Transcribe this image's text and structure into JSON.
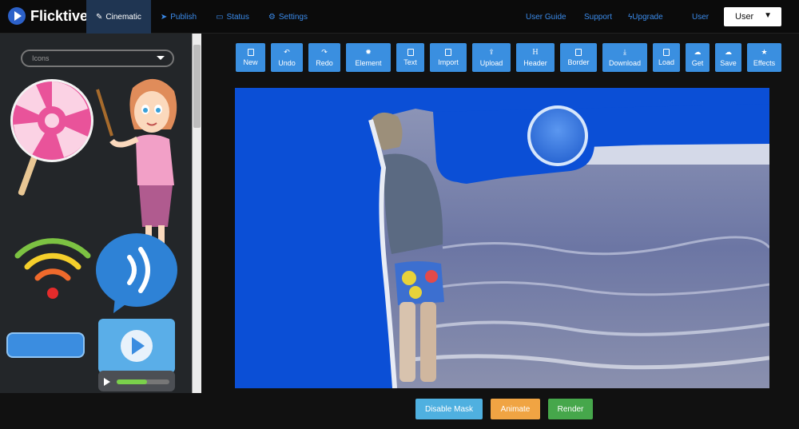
{
  "app": {
    "name": "Flicktive"
  },
  "nav": [
    {
      "label": "Cinematic",
      "icon": "pencil-icon",
      "active": true
    },
    {
      "label": "Publish",
      "icon": "paper-plane-icon",
      "active": false
    },
    {
      "label": "Status",
      "icon": "monitor-icon",
      "active": false
    },
    {
      "label": "Settings",
      "icon": "gear-icon",
      "active": false
    }
  ],
  "right_nav": {
    "user_guide": "User Guide",
    "support": "Support",
    "upgrade": "Upgrade",
    "user": "User"
  },
  "user_select": {
    "value": "User"
  },
  "sidebar": {
    "category": "Icons"
  },
  "toolbar": {
    "new": "New",
    "undo": "Undo",
    "redo": "Redo",
    "element": "Element",
    "text": "Text",
    "import": "Import",
    "upload": "Upload",
    "header": "Header",
    "border": "Border",
    "download": "Download",
    "load": "Load",
    "get": "Get",
    "save": "Save",
    "effects": "Effects"
  },
  "bottom": {
    "disable_mask": "Disable Mask",
    "animate": "Animate",
    "render": "Render"
  },
  "colors": {
    "accent": "#3a8fe0",
    "canvas_bg": "#0b4fd6",
    "animate": "#f0a443",
    "render": "#46a74b",
    "disable_mask": "#4fb0e0"
  }
}
